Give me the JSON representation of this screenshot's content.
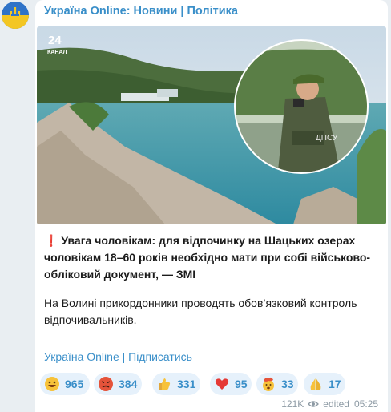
{
  "post": {
    "channel_title": "Україна Online: Новини | Політика",
    "photo_logo_number": "24",
    "photo_logo_word": "КАНАЛ",
    "photo_badge": "ДПСУ",
    "headline_mark": "❗",
    "headline": "Увага чоловікам: для відпочинку на Шацьких озерах чоловікам 18–60 років необхідно мати при собі військово-обліковий документ, — ЗМІ",
    "body": "На Волині прикордонники проводять обов’язковий контроль відпочивальників.",
    "subscribe_link": "Україна Online | Підписатись"
  },
  "reactions": [
    {
      "icon": "grinning-face-icon",
      "count": "965"
    },
    {
      "icon": "angry-face-icon",
      "count": "384"
    },
    {
      "icon": "thumbs-up-icon",
      "count": "331"
    },
    {
      "icon": "red-heart-icon",
      "count": "95"
    },
    {
      "icon": "exploding-head-icon",
      "count": "33"
    },
    {
      "icon": "folded-hands-icon",
      "count": "17"
    }
  ],
  "meta": {
    "views": "121K",
    "edited_label": "edited",
    "time": "05:25"
  },
  "colors": {
    "link": "#3a8fc9",
    "reaction_bg": "#e6f1fb",
    "meta": "#8d9aa4"
  }
}
